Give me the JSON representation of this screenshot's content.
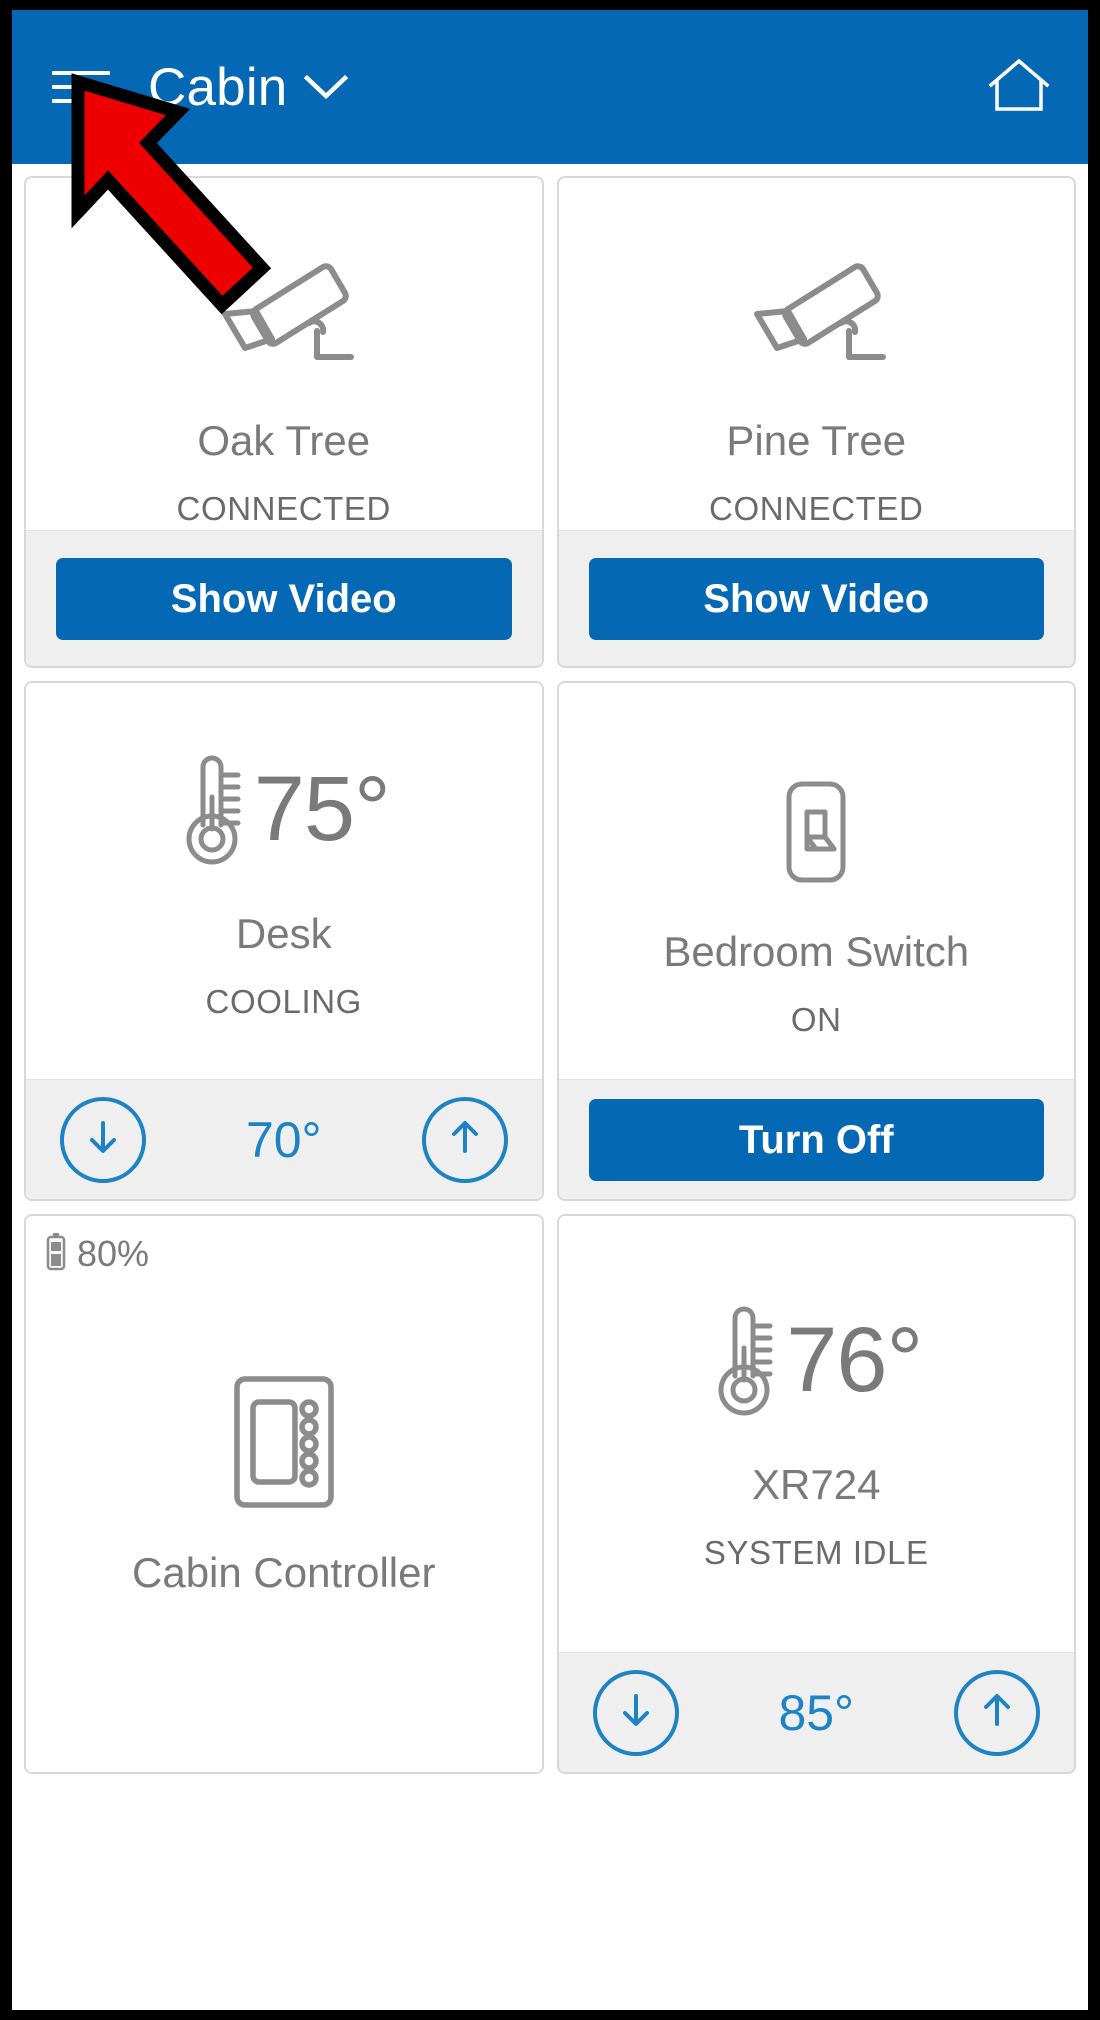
{
  "header": {
    "menu_icon": "hamburger-icon",
    "location_name": "Cabin",
    "dropdown_icon": "chevron-down-icon",
    "home_icon": "home-icon",
    "background_color": "#0568b4"
  },
  "annotation": {
    "arrow_color": "#ee0000",
    "arrow_outline_color": "#000000",
    "points_to": "hamburger-menu-button"
  },
  "colors": {
    "accent_blue": "#0568b4",
    "stepper_blue": "#1e83c4",
    "text_gray": "#7a7a7a",
    "status_gray": "#6a6a6a",
    "card_border": "#d8d8d8",
    "footer_gray": "#efefef"
  },
  "cards": [
    {
      "id": "oak-tree",
      "icon": "security-camera-icon",
      "title": "Oak Tree",
      "status": "CONNECTED",
      "action_label": "Show Video",
      "type": "camera"
    },
    {
      "id": "pine-tree",
      "icon": "security-camera-icon",
      "title": "Pine Tree",
      "status": "CONNECTED",
      "action_label": "Show Video",
      "type": "camera"
    },
    {
      "id": "desk",
      "icon": "thermometer-icon",
      "temperature": "75°",
      "title": "Desk",
      "status": "COOLING",
      "setpoint": "70°",
      "decrease_icon": "arrow-down-icon",
      "increase_icon": "arrow-up-icon",
      "type": "thermostat"
    },
    {
      "id": "bedroom-switch",
      "icon": "light-switch-icon",
      "title": "Bedroom Switch",
      "status": "ON",
      "action_label": "Turn Off",
      "type": "switch"
    },
    {
      "id": "cabin-controller",
      "icon": "wall-controller-icon",
      "battery_icon": "battery-icon",
      "battery_level": "80%",
      "title": "Cabin Controller",
      "type": "controller"
    },
    {
      "id": "xr724",
      "icon": "thermometer-icon",
      "temperature": "76°",
      "title": "XR724",
      "status": "SYSTEM IDLE",
      "setpoint": "85°",
      "decrease_icon": "arrow-down-icon",
      "increase_icon": "arrow-up-icon",
      "type": "thermostat"
    }
  ]
}
